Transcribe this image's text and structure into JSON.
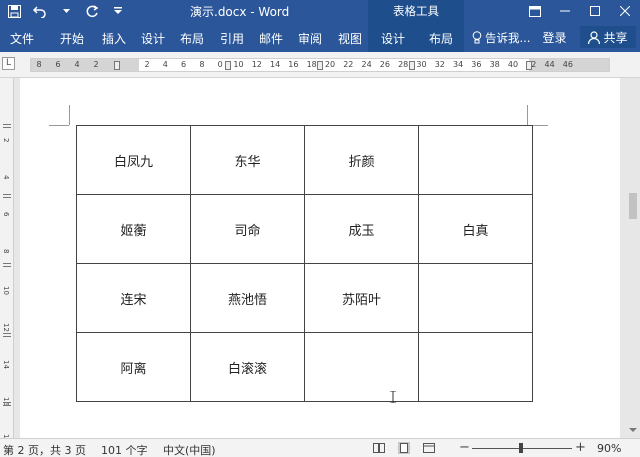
{
  "window": {
    "title": "演示.docx - Word",
    "context_group": "表格工具"
  },
  "ribbon": {
    "tabs": [
      "文件",
      "开始",
      "插入",
      "设计",
      "布局",
      "引用",
      "邮件",
      "审阅",
      "视图"
    ],
    "context_tabs": [
      "设计",
      "布局"
    ],
    "tell_me": "告诉我...",
    "signin": "登录",
    "share": "共享"
  },
  "ruler": {
    "corner": "L",
    "left_numbers": [
      "8",
      "6",
      "4",
      "2"
    ],
    "main_numbers": [
      "2",
      "4",
      "6",
      "8",
      "0",
      "10",
      "12",
      "14",
      "16",
      "18",
      "20",
      "22",
      "24",
      "26",
      "28",
      "30",
      "32",
      "34",
      "36",
      "38",
      "40",
      "42",
      "44",
      "46"
    ],
    "vertical_numbers": [
      "2",
      "4",
      "6",
      "8",
      "10",
      "12",
      "14",
      "16",
      "18"
    ]
  },
  "table": {
    "rows": [
      [
        "白凤九",
        "东华",
        "折颜",
        ""
      ],
      [
        "姬蘅",
        "司命",
        "成玉",
        "白真"
      ],
      [
        "连宋",
        "燕池悟",
        "苏陌叶",
        ""
      ],
      [
        "阿离",
        "白滚滚",
        "",
        ""
      ]
    ]
  },
  "status": {
    "page": "第 2 页，共 3 页",
    "words": "101 个字",
    "language": "中文(中国)",
    "zoom": "90%",
    "zoom_level": 0.9
  },
  "colors": {
    "accent": "#2b579a",
    "context_accent": "#1f4e8c"
  }
}
